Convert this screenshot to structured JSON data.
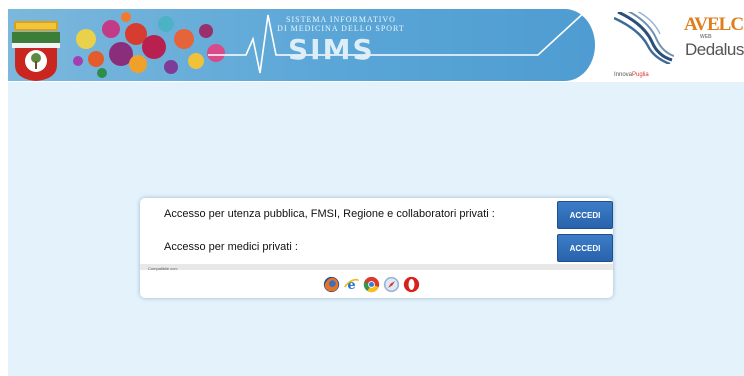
{
  "header": {
    "banner_subtitle_line1": "SISTEMA INFORMATIVO",
    "banner_subtitle_line2": "DI MEDICINA DELLO SPORT",
    "banner_title": "SIMS",
    "partner1": {
      "prefix": "Innova",
      "suffix": "Puglia"
    },
    "partner2_name": "AVELCO",
    "partner2_sub": "WEB",
    "partner3_name": "Dedalus"
  },
  "access": {
    "public_label": "Accesso per utenza pubblica, FMSI, Regione e collaboratori privati :",
    "public_button": "ACCEDI",
    "private_label": "Accesso per medici privati :",
    "private_button": "ACCEDI"
  },
  "compat": {
    "label": "Compatibile con:",
    "browsers": [
      {
        "icon": "firefox-icon"
      },
      {
        "icon": "internet-explorer-icon"
      },
      {
        "icon": "chrome-icon"
      },
      {
        "icon": "safari-icon"
      },
      {
        "icon": "opera-icon"
      }
    ]
  },
  "colors": {
    "page_background": "#e4f2fb",
    "button": "#2f6db7",
    "banner": "#5aa6d7"
  }
}
